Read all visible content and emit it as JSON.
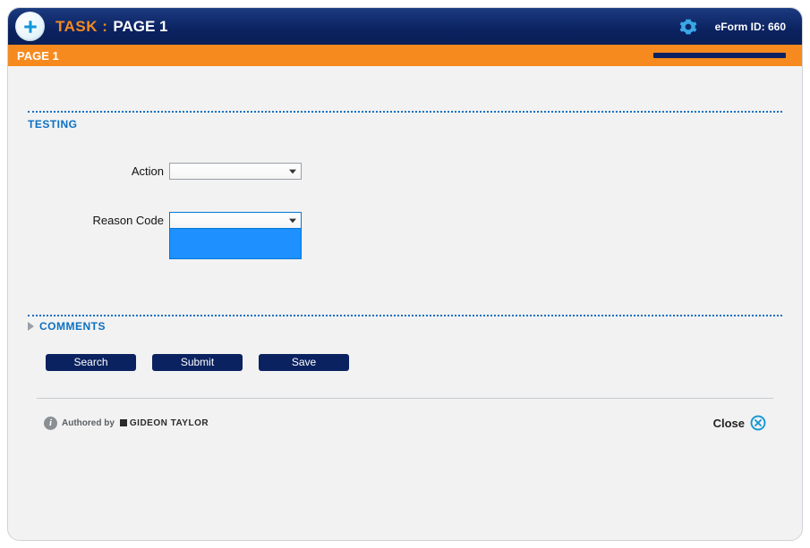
{
  "header": {
    "task_label": "TASK :",
    "page_title": "PAGE 1",
    "eform_label": "eForm ID:",
    "eform_id": "660"
  },
  "subheader": {
    "title": "PAGE 1"
  },
  "section": {
    "testing_label": "TESTING",
    "comments_label": "COMMENTS"
  },
  "fields": {
    "action": {
      "label": "Action",
      "value": ""
    },
    "reason_code": {
      "label": "Reason Code",
      "value": ""
    }
  },
  "buttons": {
    "search": "Search",
    "submit": "Submit",
    "save": "Save"
  },
  "footer": {
    "authored_by": "Authored by",
    "brand": "GIDEON TAYLOR",
    "close": "Close"
  }
}
